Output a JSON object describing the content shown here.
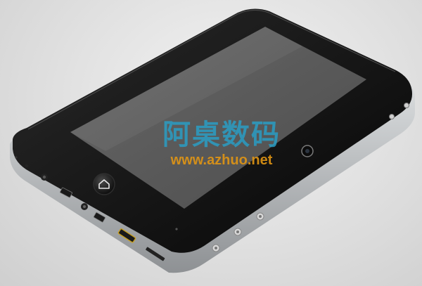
{
  "watermark": {
    "chinese_text": "阿桌数码",
    "url_text": "www.azhuo.net",
    "chinese_color": "#2aa0c8",
    "url_color": "#e19614"
  },
  "device": {
    "type": "tablet",
    "body_color": "#111111",
    "screen_color": "#5b5b5b",
    "bezel_color": "#1a1a1a",
    "frame_color": "#bfc2c4",
    "ports": [
      "headphone-jack",
      "usb",
      "usb",
      "mini-usb",
      "hdmi",
      "sd-card-slot"
    ],
    "side_buttons": [
      "volume-up",
      "volume-down",
      "power"
    ]
  }
}
